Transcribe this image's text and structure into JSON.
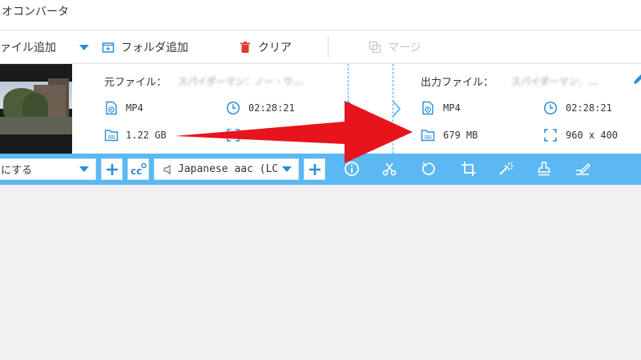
{
  "window": {
    "title": "オコンバータ"
  },
  "toolbar": {
    "add_file_label": "ァイル追加",
    "add_folder_label": "フォルダ追加",
    "clear_label": "クリア",
    "merge_label": "マージ"
  },
  "source": {
    "label": "元ファイル：",
    "name": "スパイダーマン：ノー・ウ...",
    "format": "MP4",
    "duration": "02:28:21",
    "size": "1.22 GB"
  },
  "output": {
    "label": "出力ファイル：",
    "name": "スパイダーマン：...",
    "format": "MP4",
    "duration": "02:28:21",
    "size": "679 MB",
    "resolution": "960 x 400"
  },
  "editbar": {
    "subtitle_select": "にする",
    "audio_select": "Japanese aac (LC"
  },
  "colors": {
    "accent": "#5bb8f2",
    "icon_blue": "#2a8fd6",
    "clear_red": "#e03a2e",
    "arrow_red": "#e8141b"
  }
}
